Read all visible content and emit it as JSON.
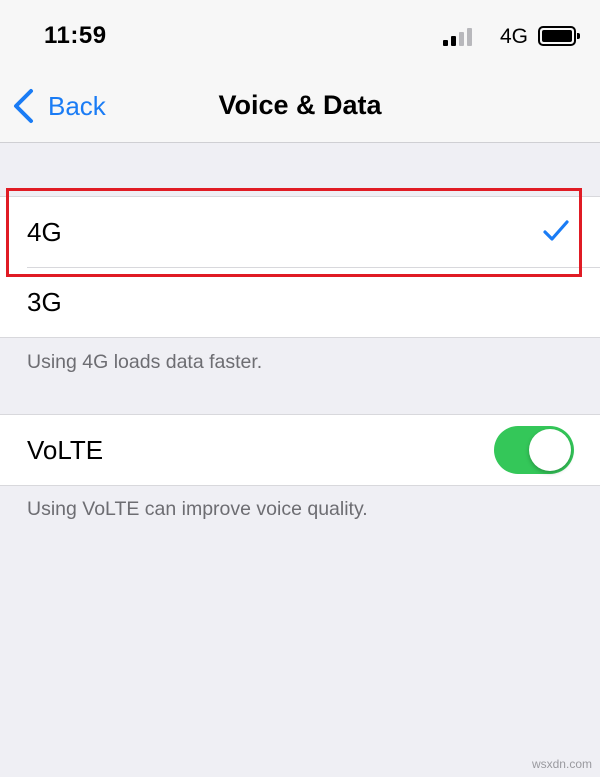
{
  "status_bar": {
    "time": "11:59",
    "network": "4G",
    "icons": [
      "signal-bars-icon",
      "battery-icon"
    ]
  },
  "nav": {
    "back_label": "Back",
    "title": "Voice & Data"
  },
  "network_options": {
    "items": [
      {
        "label": "4G",
        "selected": true
      },
      {
        "label": "3G",
        "selected": false
      }
    ],
    "footnote": "Using 4G loads data faster."
  },
  "volte": {
    "label": "VoLTE",
    "enabled": true,
    "footnote": "Using VoLTE can improve voice quality."
  },
  "watermark": "wsxdn.com",
  "colors": {
    "accent_blue": "#1a7cf5",
    "toggle_on": "#34c759",
    "highlight_red": "#e01b24",
    "background": "#efeff4"
  }
}
